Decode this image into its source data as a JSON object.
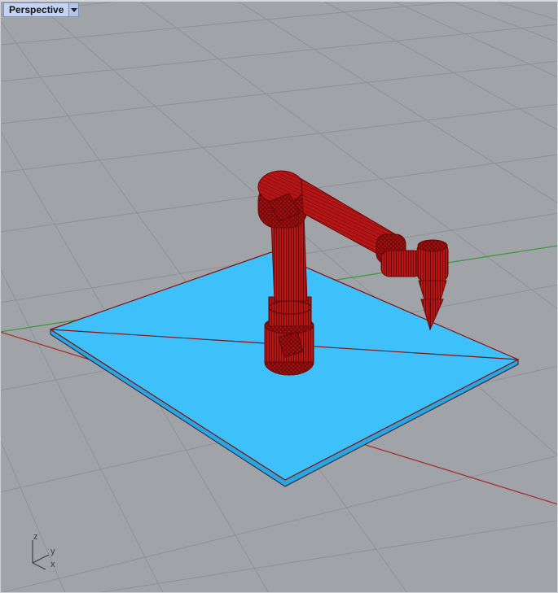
{
  "viewport": {
    "title": "Perspective",
    "menu_icon": "triangle-down-icon"
  },
  "axis_widget": {
    "z_label": "z",
    "y_label": "y",
    "x_label": "x"
  },
  "colors": {
    "background": "#a0a3a8",
    "grid": "#8c8f94",
    "plate": "#3ec0fb",
    "plate_edge": "#8a0e0e",
    "robot": "#a90f0f",
    "x_axis": "#a8302b",
    "y_axis": "#3d9a3d",
    "tab_bg": "#c4d3f2"
  }
}
